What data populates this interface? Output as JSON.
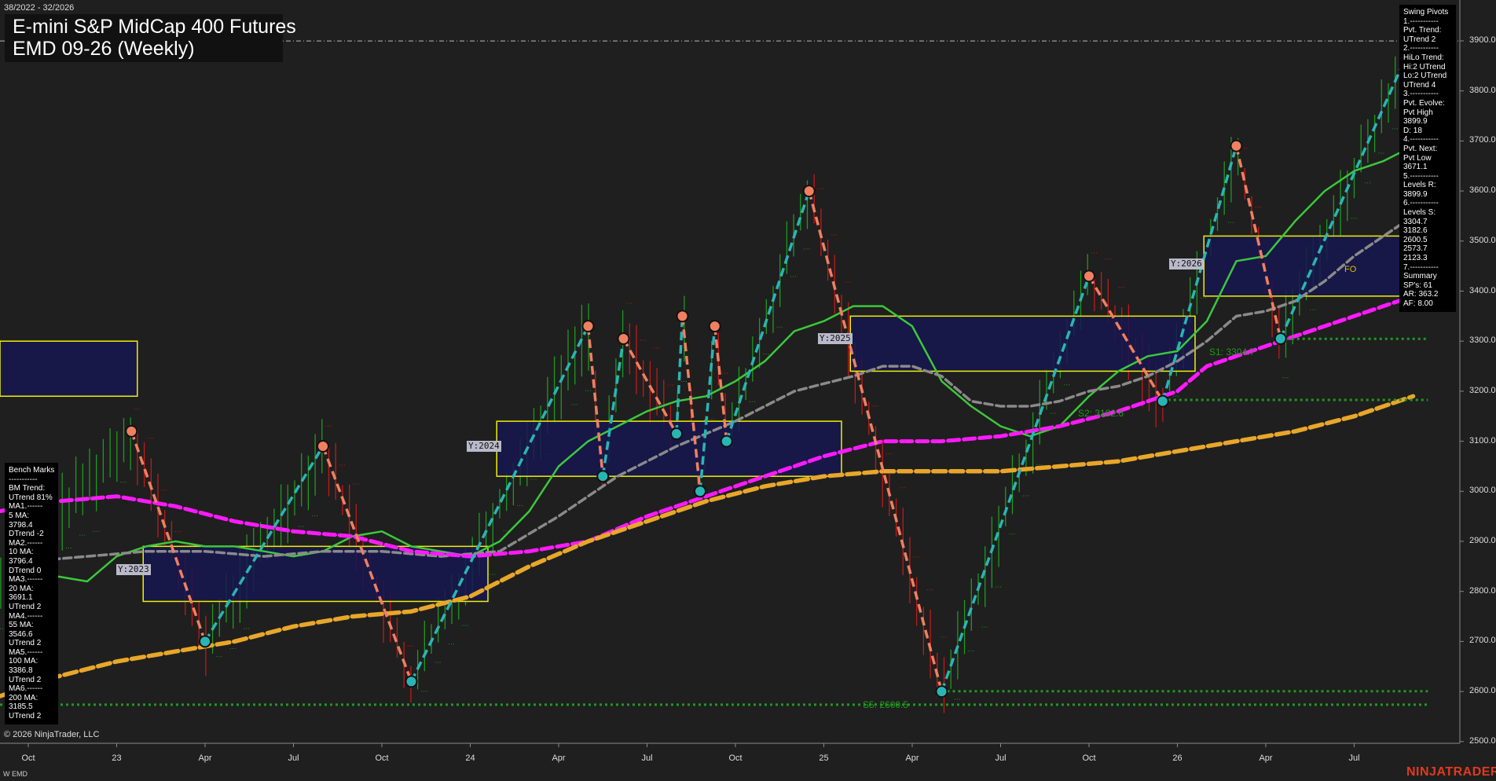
{
  "header": {
    "range": "38/2022 - 32/2026",
    "title_line1": "E-mini S&P MidCap 400 Futures",
    "title_line2": "EMD 09-26 (Weekly)"
  },
  "swing_pivots_panel": {
    "lines": [
      "Swing Pivots",
      "1.-----------",
      "Pvt. Trend:",
      "UTrend 2",
      "2.-----------",
      "HiLo Trend:",
      "Hi:2 UTrend",
      "Lo:2 UTrend",
      "UTrend 4",
      "3.-----------",
      "Pvt. Evolve:",
      "Pvt High",
      "3899.9",
      "D: 18",
      "4.-----------",
      "Pvt. Next:",
      "Pvt Low",
      "3671.1",
      "5.-----------",
      "Levels R:",
      "3899.9",
      "6.-----------",
      "Levels S:",
      "3304.7",
      "3182.6",
      "2600.5",
      "2573.7",
      "2123.3",
      "7.-----------",
      "Summary",
      "SP's: 61",
      "AR: 363.2",
      "AF: 8.00"
    ]
  },
  "benchmarks_panel": {
    "lines": [
      "Bench Marks",
      "-----------",
      "BM Trend:",
      "UTrend 81%",
      "MA1.------",
      "5 MA:",
      "3798.4",
      "DTrend -2",
      "MA2.------",
      "10 MA:",
      "3796.4",
      "DTrend 0",
      "MA3.------",
      "20 MA:",
      "3691.1",
      "UTrend 2",
      "MA4.------",
      "55 MA:",
      "3546.6",
      "UTrend 2",
      "MA5.------",
      "100 MA:",
      "3386.8",
      "UTrend 2",
      "MA6.------",
      "200 MA:",
      "3185.5",
      "UTrend 2"
    ]
  },
  "footer": {
    "copyright": "© 2026 NinjaTrader, LLC",
    "instrument_code": "W EMD",
    "brand": "NINJATRADER"
  },
  "zone_labels": {
    "y2023": "Y:2023",
    "y2024": "Y:2024",
    "y2025": "Y:2025",
    "y2026": "Y:2026",
    "fo": "FO"
  },
  "level_labels": {
    "s1": "S1: 3304.7",
    "s2": "S2: 3182.6",
    "s5": "S5: 2600.5"
  },
  "colors": {
    "background": "#1f1f1f",
    "bull_bar": "#1f9a1f",
    "bear_bar": "#c11a1a",
    "ma_fast": "#3cc83c",
    "ma_mid": "#8a8a8a",
    "ma_magenta": "#ff1aff",
    "ma_gold": "#e8a72a",
    "pivot_up_line": "#2ab5b5",
    "pivot_down_line": "#f08060",
    "zone_fill": "#161650",
    "zone_border": "#f0f000",
    "level_line": "#1e9a1e",
    "brand": "#e23a1e"
  },
  "chart_data": {
    "type": "candlestick",
    "instrument": "E-mini S&P MidCap 400 Futures",
    "timeframe": "Weekly",
    "y_axis": {
      "range": [
        2500,
        3950
      ],
      "ticks": [
        "3900.0",
        "3800.0",
        "3700.0",
        "3600.0",
        "3500.0",
        "3400.0",
        "3300.0",
        "3200.0",
        "3100.0",
        "3000.0",
        "2900.0",
        "2800.0",
        "2700.0",
        "2600.0",
        "2500.0"
      ]
    },
    "x_axis": {
      "ticks": [
        "Oct",
        "23",
        "Apr",
        "Jul",
        "Oct",
        "24",
        "Apr",
        "Jul",
        "Oct",
        "25",
        "Apr",
        "Jul",
        "Oct",
        "26",
        "Apr",
        "Jul"
      ]
    },
    "resistance_line": 3899.9,
    "support_levels": [
      3304.7,
      3182.6,
      2600.5,
      2573.7
    ],
    "swing_pivots": [
      {
        "t": 3.5,
        "v": 3120,
        "type": "high"
      },
      {
        "t": 6.0,
        "v": 2700,
        "type": "low"
      },
      {
        "t": 10.0,
        "v": 3090,
        "type": "high"
      },
      {
        "t": 13.0,
        "v": 2620,
        "type": "low"
      },
      {
        "t": 19.0,
        "v": 3330,
        "type": "high"
      },
      {
        "t": 19.5,
        "v": 3030,
        "type": "low"
      },
      {
        "t": 20.2,
        "v": 3305,
        "type": "high"
      },
      {
        "t": 22.0,
        "v": 3115,
        "type": "low"
      },
      {
        "t": 22.2,
        "v": 3350,
        "type": "high"
      },
      {
        "t": 22.8,
        "v": 3000,
        "type": "low"
      },
      {
        "t": 23.3,
        "v": 3330,
        "type": "high"
      },
      {
        "t": 23.7,
        "v": 3100,
        "type": "low"
      },
      {
        "t": 26.5,
        "v": 3600,
        "type": "high"
      },
      {
        "t": 31.0,
        "v": 2600,
        "type": "low"
      },
      {
        "t": 36.0,
        "v": 3430,
        "type": "high"
      },
      {
        "t": 38.5,
        "v": 3180,
        "type": "low"
      },
      {
        "t": 41.0,
        "v": 3690,
        "type": "high"
      },
      {
        "t": 42.5,
        "v": 3305,
        "type": "low"
      },
      {
        "t": 47.0,
        "v": 3899.9,
        "type": "high"
      }
    ],
    "yearly_zones": [
      {
        "label": "prior",
        "t0": -1.0,
        "t1": 3.7,
        "v_low": 3190,
        "v_high": 3300
      },
      {
        "label": "Y:2023",
        "t0": 3.9,
        "t1": 15.6,
        "v_low": 2780,
        "v_high": 2890
      },
      {
        "label": "Y:2024",
        "t0": 15.9,
        "t1": 27.6,
        "v_low": 3030,
        "v_high": 3140
      },
      {
        "label": "Y:2025",
        "t0": 27.9,
        "t1": 39.6,
        "v_low": 3240,
        "v_high": 3350
      },
      {
        "label": "Y:2026",
        "t0": 39.9,
        "t1": 47.0,
        "v_low": 3390,
        "v_high": 3510
      }
    ],
    "moving_averages": [
      {
        "name": "fast",
        "color": "#3cc83c",
        "points": [
          [
            0,
            2780
          ],
          [
            1,
            2830
          ],
          [
            2,
            2820
          ],
          [
            3,
            2870
          ],
          [
            4,
            2890
          ],
          [
            5,
            2900
          ],
          [
            6,
            2890
          ],
          [
            7,
            2890
          ],
          [
            8,
            2880
          ],
          [
            9,
            2870
          ],
          [
            10,
            2880
          ],
          [
            11,
            2910
          ],
          [
            12,
            2920
          ],
          [
            13,
            2890
          ],
          [
            14,
            2880
          ],
          [
            15,
            2870
          ],
          [
            16,
            2900
          ],
          [
            17,
            2960
          ],
          [
            18,
            3050
          ],
          [
            19,
            3100
          ],
          [
            20,
            3130
          ],
          [
            21,
            3160
          ],
          [
            22,
            3180
          ],
          [
            23,
            3190
          ],
          [
            24,
            3220
          ],
          [
            25,
            3260
          ],
          [
            26,
            3320
          ],
          [
            27,
            3340
          ],
          [
            28,
            3370
          ],
          [
            29,
            3370
          ],
          [
            30,
            3330
          ],
          [
            31,
            3220
          ],
          [
            32,
            3170
          ],
          [
            33,
            3130
          ],
          [
            34,
            3110
          ],
          [
            35,
            3130
          ],
          [
            36,
            3190
          ],
          [
            37,
            3240
          ],
          [
            38,
            3270
          ],
          [
            39,
            3280
          ],
          [
            40,
            3340
          ],
          [
            41,
            3460
          ],
          [
            42,
            3470
          ],
          [
            43,
            3540
          ],
          [
            44,
            3600
          ],
          [
            45,
            3640
          ],
          [
            46,
            3660
          ],
          [
            47,
            3690
          ]
        ]
      },
      {
        "name": "mid",
        "color": "#8a8a8a",
        "points": [
          [
            0,
            2860
          ],
          [
            2,
            2870
          ],
          [
            4,
            2880
          ],
          [
            6,
            2880
          ],
          [
            8,
            2870
          ],
          [
            10,
            2880
          ],
          [
            12,
            2880
          ],
          [
            14,
            2870
          ],
          [
            16,
            2880
          ],
          [
            18,
            2950
          ],
          [
            20,
            3030
          ],
          [
            22,
            3090
          ],
          [
            24,
            3140
          ],
          [
            26,
            3200
          ],
          [
            28,
            3230
          ],
          [
            29,
            3250
          ],
          [
            30,
            3250
          ],
          [
            31,
            3230
          ],
          [
            32,
            3180
          ],
          [
            33,
            3170
          ],
          [
            34,
            3170
          ],
          [
            35,
            3180
          ],
          [
            36,
            3200
          ],
          [
            37,
            3210
          ],
          [
            38,
            3230
          ],
          [
            39,
            3260
          ],
          [
            40,
            3300
          ],
          [
            41,
            3350
          ],
          [
            42,
            3360
          ],
          [
            43,
            3380
          ],
          [
            44,
            3420
          ],
          [
            45,
            3470
          ],
          [
            46,
            3510
          ],
          [
            47,
            3550
          ]
        ]
      },
      {
        "name": "magenta",
        "color": "#ff1aff",
        "points": [
          [
            -1,
            2960
          ],
          [
            1,
            2980
          ],
          [
            3,
            2990
          ],
          [
            5,
            2970
          ],
          [
            7,
            2940
          ],
          [
            9,
            2920
          ],
          [
            11,
            2910
          ],
          [
            13,
            2880
          ],
          [
            15,
            2870
          ],
          [
            17,
            2880
          ],
          [
            19,
            2900
          ],
          [
            21,
            2950
          ],
          [
            23,
            2990
          ],
          [
            25,
            3030
          ],
          [
            27,
            3070
          ],
          [
            29,
            3100
          ],
          [
            31,
            3100
          ],
          [
            33,
            3110
          ],
          [
            35,
            3130
          ],
          [
            37,
            3160
          ],
          [
            39,
            3200
          ],
          [
            40,
            3250
          ],
          [
            41,
            3270
          ],
          [
            42,
            3290
          ],
          [
            43,
            3310
          ],
          [
            44,
            3330
          ],
          [
            45,
            3350
          ],
          [
            46,
            3370
          ],
          [
            47,
            3390
          ]
        ]
      },
      {
        "name": "gold",
        "color": "#e8a72a",
        "points": [
          [
            -1,
            2590
          ],
          [
            1,
            2630
          ],
          [
            3,
            2660
          ],
          [
            5,
            2680
          ],
          [
            7,
            2700
          ],
          [
            9,
            2730
          ],
          [
            11,
            2750
          ],
          [
            13,
            2760
          ],
          [
            15,
            2790
          ],
          [
            17,
            2850
          ],
          [
            19,
            2900
          ],
          [
            21,
            2940
          ],
          [
            23,
            2980
          ],
          [
            25,
            3010
          ],
          [
            27,
            3030
          ],
          [
            29,
            3040
          ],
          [
            31,
            3040
          ],
          [
            33,
            3040
          ],
          [
            35,
            3050
          ],
          [
            37,
            3060
          ],
          [
            39,
            3080
          ],
          [
            41,
            3100
          ],
          [
            43,
            3120
          ],
          [
            45,
            3150
          ],
          [
            47,
            3190
          ]
        ]
      }
    ]
  }
}
